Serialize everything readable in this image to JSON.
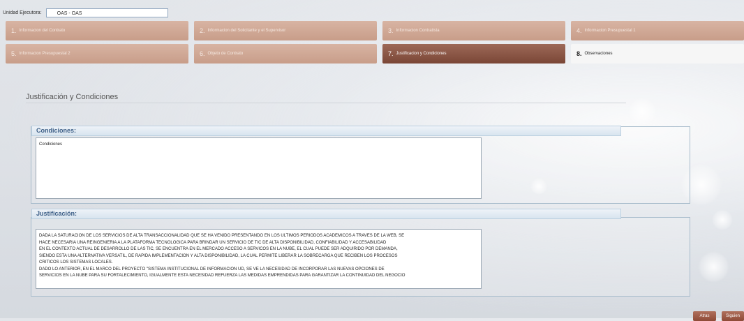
{
  "header": {
    "unidad_label": "Unidad Ejecutora:",
    "unidad_value": "OAS - OAS"
  },
  "tabs": [
    {
      "num": "1.",
      "label": "Informacion del Contrato"
    },
    {
      "num": "2.",
      "label": "Informacion del Solicitante y el Supervisor"
    },
    {
      "num": "3.",
      "label": "Informacion Contratista"
    },
    {
      "num": "4.",
      "label": "Informacion Presupuestal 1"
    },
    {
      "num": "5.",
      "label": "Informacion Presupuestal 2"
    },
    {
      "num": "6.",
      "label": "Objeto de Contrato"
    },
    {
      "num": "7.",
      "label": "Justificacion y Condiciones"
    },
    {
      "num": "8.",
      "label": "Observaciones"
    }
  ],
  "section": {
    "title": "Justificación y Condiciones"
  },
  "condiciones": {
    "header": "Condiciones:",
    "value": "Condiciones"
  },
  "justificacion": {
    "header": "Justificación:",
    "lines": [
      "DADA LA SATURACION DE LOS SERVICIOS DE ALTA TRANSACCIONALIDAD QUE SE HA VENIDO PRESENTANDO EN LOS ULTIMOS PERIODOS ACADEMICOS A TRAVES DE LA WEB, SE",
      "HACE NECESARIA UNA REINGENIERIA A LA PLATAFORMA TECNOLOGICA PARA BRINDAR UN SERVICIO DE TIC DE ALTA DISPONIBILIDAD, CONFIABILIDAD Y ACCESABILIDAD",
      "EN EL CONTEXTO ACTUAL DE DESARROLLO DE LAS TIC, SE ENCUENTRA EN EL MERCADO ACCESO A SERVICOS EN LA NUBE, EL CUAL PUEDE SER ADQUIRIDO POR DEMANDA,",
      "SIENDO ESTA UNA ALTERNATIVA VERSATIL, DE RAPIDA IMPLEMENTACION Y ALTA DISPONIBILIDAD, LA CUAL PERMITE LIBERAR LA SOBRECARGA QUE RECIBEN LOS PROCESOS",
      "CRITICOS LOS SISTEMAS LOCALES.",
      "DADO LO ANTERIOR, EN EL MARCO DEL PROYECTO \"SISTEMA INSTITUCIONAL DE INFORMACION UD, SE VE LA NECESIDAD DE INCORPORAR LAS NUEVAS OPCIONES DE",
      "SERVICIOS EN LA NUBE PARA SU FORTALECIMIENTO, IGUALMENTE ESTA NECESIDAD REFUERZA LAS MEDIDAS EMPRENDIDAS PARA GARANTIZAR LA CONTINUIDAD DEL NEGOCIO"
    ]
  },
  "buttons": {
    "back": "Atras",
    "next": "Siguien"
  }
}
